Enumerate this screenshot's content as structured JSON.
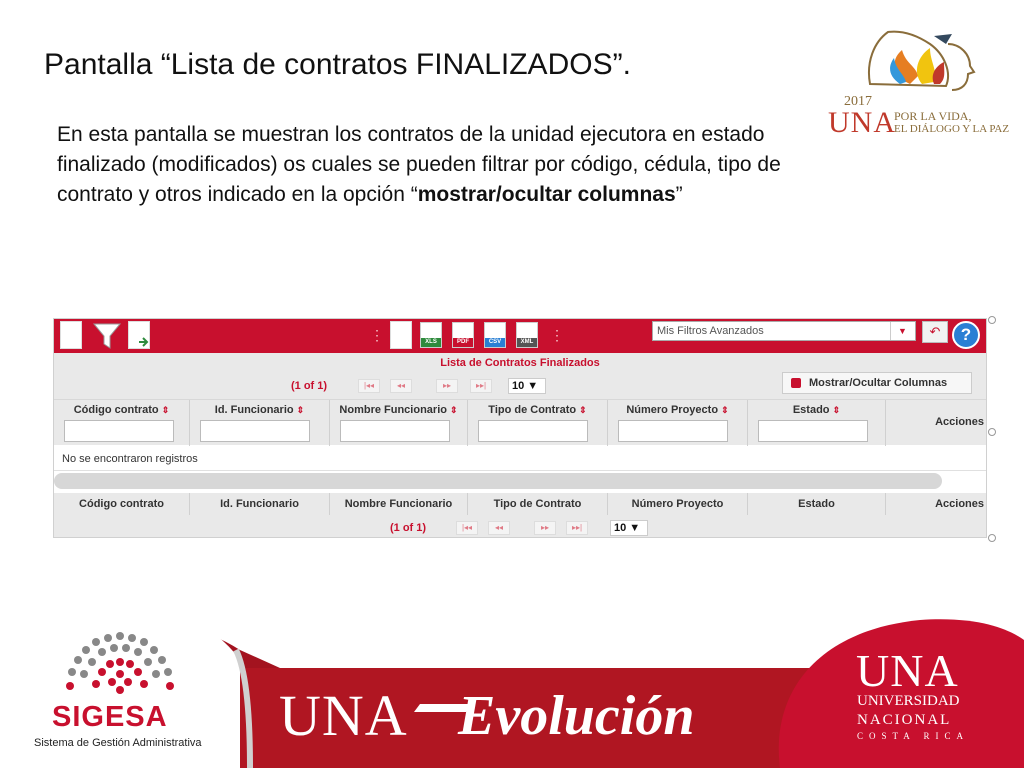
{
  "slide": {
    "title": "Pantalla  “Lista de contratos FINALIZADOS”.",
    "body_text": "En esta pantalla se muestran los contratos de la unidad ejecutora en estado finalizado (modificados) os cuales se pueden filtrar por código, cédula, tipo de contrato y otros indicado en la opción “",
    "body_bold": "mostrar/ocultar columnas",
    "body_end": "”"
  },
  "logo_2017": {
    "year": "2017",
    "brand": "UNA",
    "tagline_1": "POR LA VIDA,",
    "tagline_2": "EL DIÁLOGO Y LA PAZ"
  },
  "app": {
    "toolbar": {
      "exports": [
        "XLS",
        "PDF",
        "CSV",
        "XML"
      ],
      "export_colors": [
        "#2e8b3d",
        "#c8102e",
        "#2a7fd4",
        "#555555"
      ],
      "filters_select": "Mis Filtros Avanzados",
      "help_label": "?"
    },
    "grid_title": "Lista de Contratos Finalizados",
    "pager": {
      "count": "(1 of 1)",
      "page_size": "10 ▼",
      "first": "|◂◂",
      "prev": "◂◂",
      "next": "▸▸",
      "last": "▸▸|"
    },
    "show_hide_columns": "Mostrar/Ocultar Columnas",
    "columns": [
      "Código contrato",
      "Id. Funcionario",
      "Nombre Funcionario",
      "Tipo de Contrato",
      "Número Proyecto",
      "Estado",
      "Acciones"
    ],
    "sort_glyph": "⇕",
    "empty_message": "No se encontraron registros"
  },
  "footer": {
    "sigesa_name": "SIGESA",
    "sigesa_subtitle": "Sistema de Gestión Administrativa",
    "banner_una": "UNA",
    "banner_evolucion": "Evolución",
    "univ_brand": "UNA",
    "univ_line1": "UNIVERSIDAD",
    "univ_line2": "NACIONAL",
    "univ_line3": "COSTA RICA"
  },
  "colors": {
    "brand_red": "#c8102e",
    "banner_dark_red": "#a3131f"
  }
}
